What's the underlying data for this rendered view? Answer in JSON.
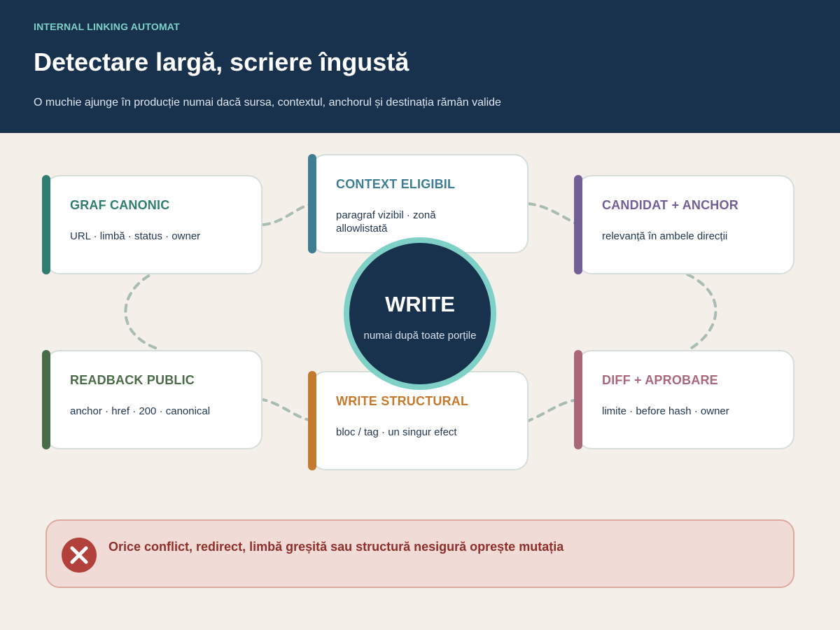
{
  "header": {
    "eyebrow": "INTERNAL LINKING AUTOMAT",
    "title": "Detectare largă, scriere îngustă",
    "subtitle": "O muchie ajunge în producție numai dacă sursa, contextul, anchorul și destinația rămân valide"
  },
  "nodes": {
    "graf_canonic": {
      "title": "GRAF CANONIC",
      "text": "URL · limbă · status · owner",
      "color": "#2f7d70"
    },
    "context_eligibil": {
      "title": "CONTEXT ELIGIBIL",
      "text": "paragraf vizibil · zonă allowlistată",
      "color": "#3f7d92"
    },
    "candidat_anchor": {
      "title": "CANDIDAT + ANCHOR",
      "text": "relevanță în ambele direcții",
      "color": "#725f96"
    },
    "readback_public": {
      "title": "READBACK PUBLIC",
      "text": "anchor · href · 200 · canonical",
      "color": "#4a6b47"
    },
    "write_structural": {
      "title": "WRITE STRUCTURAL",
      "text": "bloc / tag · un singur efect",
      "color": "#c47a2c"
    },
    "diff_aprobare": {
      "title": "DIFF + APROBARE",
      "text": "limite · before hash · owner",
      "color": "#a8687a"
    }
  },
  "hub": {
    "title": "WRITE",
    "subtitle": "numai după toate porțile"
  },
  "alert": {
    "text": "Orice conflict, redirect, limbă greșită sau structură nesigură oprește mutația",
    "icon": "close-icon"
  },
  "colors": {
    "header_bg": "#18324e",
    "accent": "#7fd1c7",
    "connector": "#a9bcb4",
    "alert_bg": "#f0dbd6",
    "alert_icon": "#b2403b"
  }
}
